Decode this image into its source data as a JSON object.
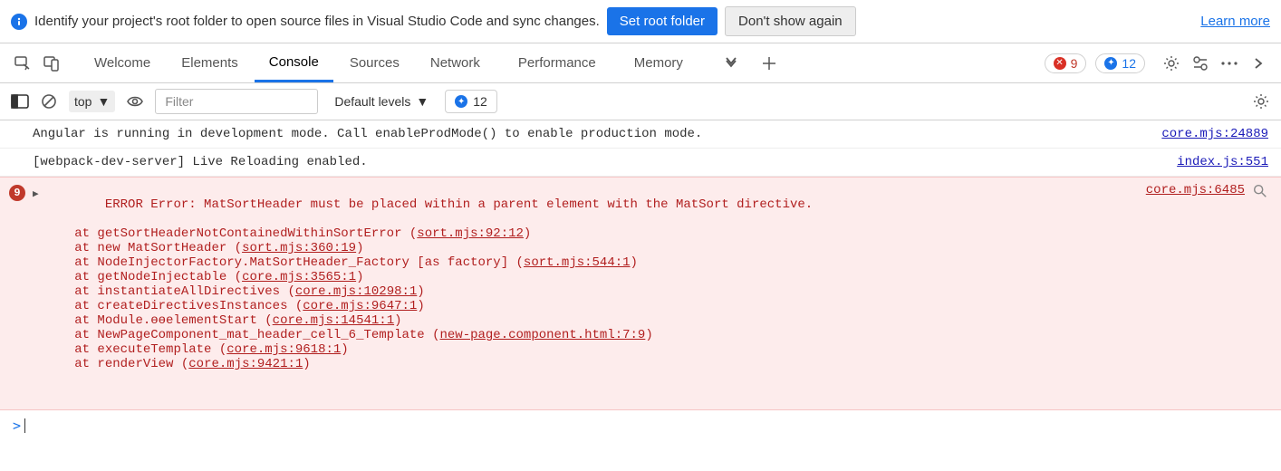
{
  "infobar": {
    "text": "Identify your project's root folder to open source files in Visual Studio Code and sync changes.",
    "primary": "Set root folder",
    "secondary": "Don't show again",
    "learn": "Learn more"
  },
  "tabs": {
    "items": [
      "Welcome",
      "Elements",
      "Console",
      "Sources",
      "Network",
      "Performance",
      "Memory"
    ],
    "active": "Console",
    "error_count": "9",
    "issue_count": "12"
  },
  "toolbar": {
    "context": "top",
    "filter_placeholder": "Filter",
    "levels": "Default levels",
    "issues_label": "12"
  },
  "console": {
    "lines": [
      {
        "text": "Angular is running in development mode. Call enableProdMode() to enable production mode.",
        "src": "core.mjs:24889"
      },
      {
        "text": "[webpack-dev-server] Live Reloading enabled.",
        "src": "index.js:551"
      }
    ],
    "error": {
      "headline": "ERROR Error: MatSortHeader must be placed within a parent element with the MatSort directive.",
      "src": "core.mjs:6485",
      "count": "9",
      "stack": [
        {
          "pre": "    at getSortHeaderNotContainedWithinSortError (",
          "link": "sort.mjs:92:12",
          "post": ")"
        },
        {
          "pre": "    at new MatSortHeader (",
          "link": "sort.mjs:360:19",
          "post": ")"
        },
        {
          "pre": "    at NodeInjectorFactory.MatSortHeader_Factory [as factory] (",
          "link": "sort.mjs:544:1",
          "post": ")"
        },
        {
          "pre": "    at getNodeInjectable (",
          "link": "core.mjs:3565:1",
          "post": ")"
        },
        {
          "pre": "    at instantiateAllDirectives (",
          "link": "core.mjs:10298:1",
          "post": ")"
        },
        {
          "pre": "    at createDirectivesInstances (",
          "link": "core.mjs:9647:1",
          "post": ")"
        },
        {
          "pre": "    at Module.ɵɵelementStart (",
          "link": "core.mjs:14541:1",
          "post": ")"
        },
        {
          "pre": "    at NewPageComponent_mat_header_cell_6_Template (",
          "link": "new-page.component.html:7:9",
          "post": ")"
        },
        {
          "pre": "    at executeTemplate (",
          "link": "core.mjs:9618:1",
          "post": ")"
        },
        {
          "pre": "    at renderView (",
          "link": "core.mjs:9421:1",
          "post": ")"
        }
      ]
    },
    "prompt": ">"
  }
}
